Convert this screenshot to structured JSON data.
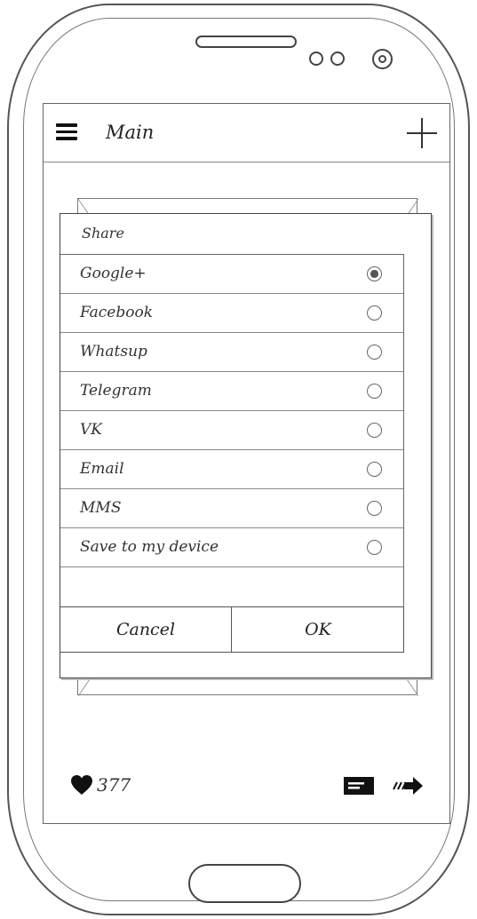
{
  "appbar": {
    "title": "Main"
  },
  "dialog": {
    "title": "Share",
    "options": [
      {
        "label": "Google+",
        "selected": true
      },
      {
        "label": "Facebook",
        "selected": false
      },
      {
        "label": "Whatsup",
        "selected": false
      },
      {
        "label": "Telegram",
        "selected": false
      },
      {
        "label": "VK",
        "selected": false
      },
      {
        "label": "Email",
        "selected": false
      },
      {
        "label": "MMS",
        "selected": false
      },
      {
        "label": "Save to my device",
        "selected": false
      }
    ],
    "cancel_label": "Cancel",
    "ok_label": "OK"
  },
  "footer": {
    "likes_count": "377"
  },
  "icons": {
    "menu": "menu-icon",
    "add": "plus-icon",
    "like": "heart-icon",
    "comment": "comment-icon",
    "share": "share-arrow-icon"
  }
}
